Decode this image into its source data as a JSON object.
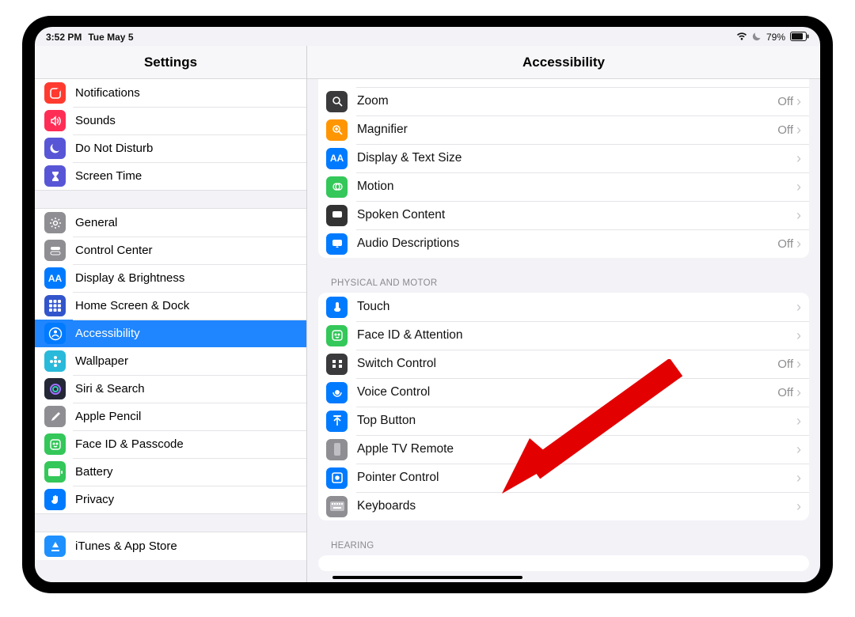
{
  "status": {
    "time": "3:52 PM",
    "date": "Tue May 5",
    "battery": "79%"
  },
  "sidebar": {
    "title": "Settings",
    "items": [
      {
        "label": "Notifications",
        "iconColor": "#ff3b30",
        "iconGlyph": "notification"
      },
      {
        "label": "Sounds",
        "iconColor": "#ff2d55",
        "iconGlyph": "sounds"
      },
      {
        "label": "Do Not Disturb",
        "iconColor": "#5856d6",
        "iconGlyph": "moon"
      },
      {
        "label": "Screen Time",
        "iconColor": "#5856d6",
        "iconGlyph": "hourglass"
      }
    ],
    "items2": [
      {
        "label": "General",
        "iconColor": "#8e8e93",
        "iconGlyph": "gear"
      },
      {
        "label": "Control Center",
        "iconColor": "#8e8e93",
        "iconGlyph": "toggles"
      },
      {
        "label": "Display & Brightness",
        "iconColor": "#007aff",
        "iconGlyph": "AA"
      },
      {
        "label": "Home Screen & Dock",
        "iconColor": "#3355cc",
        "iconGlyph": "grid"
      },
      {
        "label": "Accessibility",
        "iconColor": "#007aff",
        "iconGlyph": "person",
        "selected": true
      },
      {
        "label": "Wallpaper",
        "iconColor": "#29b9da",
        "iconGlyph": "flower"
      },
      {
        "label": "Siri & Search",
        "iconColor": "#232736",
        "iconGlyph": "siri"
      },
      {
        "label": "Apple Pencil",
        "iconColor": "#8e8e93",
        "iconGlyph": "pencil"
      },
      {
        "label": "Face ID & Passcode",
        "iconColor": "#34c759",
        "iconGlyph": "face"
      },
      {
        "label": "Battery",
        "iconColor": "#34c759",
        "iconGlyph": "battery"
      },
      {
        "label": "Privacy",
        "iconColor": "#007aff",
        "iconGlyph": "hand"
      }
    ],
    "items3": [
      {
        "label": "iTunes & App Store",
        "iconColor": "#1e90ff",
        "iconGlyph": "appstore"
      }
    ]
  },
  "detail": {
    "title": "Accessibility",
    "section_vision": [
      {
        "label": "Zoom",
        "value": "Off",
        "iconColor": "#3a3a3c",
        "iconGlyph": "zoom"
      },
      {
        "label": "Magnifier",
        "value": "Off",
        "iconColor": "#ff9500",
        "iconGlyph": "magnifier"
      },
      {
        "label": "Display & Text Size",
        "value": "",
        "iconColor": "#007aff",
        "iconGlyph": "AA"
      },
      {
        "label": "Motion",
        "value": "",
        "iconColor": "#34c759",
        "iconGlyph": "motion"
      },
      {
        "label": "Spoken Content",
        "value": "",
        "iconColor": "#333",
        "iconGlyph": "speech"
      },
      {
        "label": "Audio Descriptions",
        "value": "Off",
        "iconColor": "#007aff",
        "iconGlyph": "ad"
      }
    ],
    "section_physical_header": "Physical and Motor",
    "section_physical": [
      {
        "label": "Touch",
        "value": "",
        "iconColor": "#007aff",
        "iconGlyph": "touch"
      },
      {
        "label": "Face ID & Attention",
        "value": "",
        "iconColor": "#34c759",
        "iconGlyph": "face"
      },
      {
        "label": "Switch Control",
        "value": "Off",
        "iconColor": "#3a3a3c",
        "iconGlyph": "switches"
      },
      {
        "label": "Voice Control",
        "value": "Off",
        "iconColor": "#007aff",
        "iconGlyph": "voice"
      },
      {
        "label": "Top Button",
        "value": "",
        "iconColor": "#007aff",
        "iconGlyph": "topbutton"
      },
      {
        "label": "Apple TV Remote",
        "value": "",
        "iconColor": "#8e8e93",
        "iconGlyph": "remote"
      },
      {
        "label": "Pointer Control",
        "value": "",
        "iconColor": "#007aff",
        "iconGlyph": "pointer"
      },
      {
        "label": "Keyboards",
        "value": "",
        "iconColor": "#8e8e93",
        "iconGlyph": "keyboard"
      }
    ],
    "section_hearing_header": "Hearing"
  }
}
